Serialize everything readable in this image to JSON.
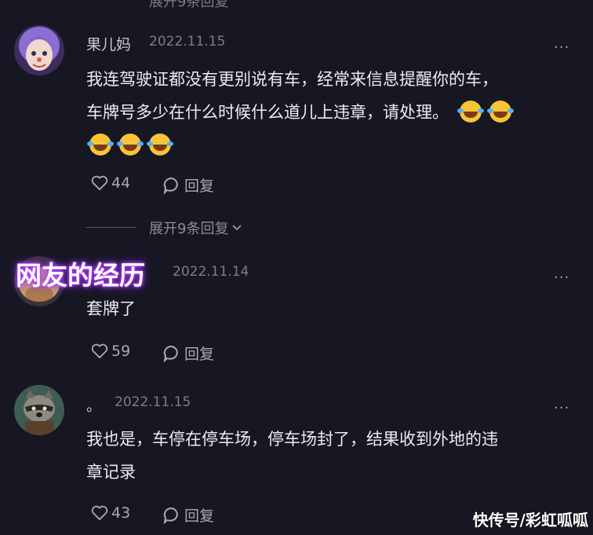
{
  "top_partial": "展开9条回复",
  "comments": [
    {
      "name": "果儿妈",
      "date": "2022.11.15",
      "text_lines": [
        "我连驾驶证都没有更别说有车，经常来信息提醒你的车，",
        "车牌号多少在什么时候什么道儿上违章，请处理。"
      ],
      "likes": "44",
      "reply_label": "回复",
      "emoji_name": "laughing-tears"
    },
    {
      "name": "",
      "date": "2022.11.14",
      "text_lines": [
        "套牌了"
      ],
      "likes": "59",
      "reply_label": "回复"
    },
    {
      "name": "。",
      "date": "2022.11.15",
      "text_lines": [
        "我也是，车停在停车场，停车场封了，结果收到外地的违",
        "章记录"
      ],
      "likes": "43",
      "reply_label": "回复"
    }
  ],
  "expand_replies": "展开9条回复",
  "more_glyph": "···",
  "banner_text": "网友的经历",
  "watermark": "快传号/彩虹呱呱",
  "colors": {
    "background": "#161722",
    "banner_glow": "#9b2cff",
    "emoji": "#f8c437"
  }
}
